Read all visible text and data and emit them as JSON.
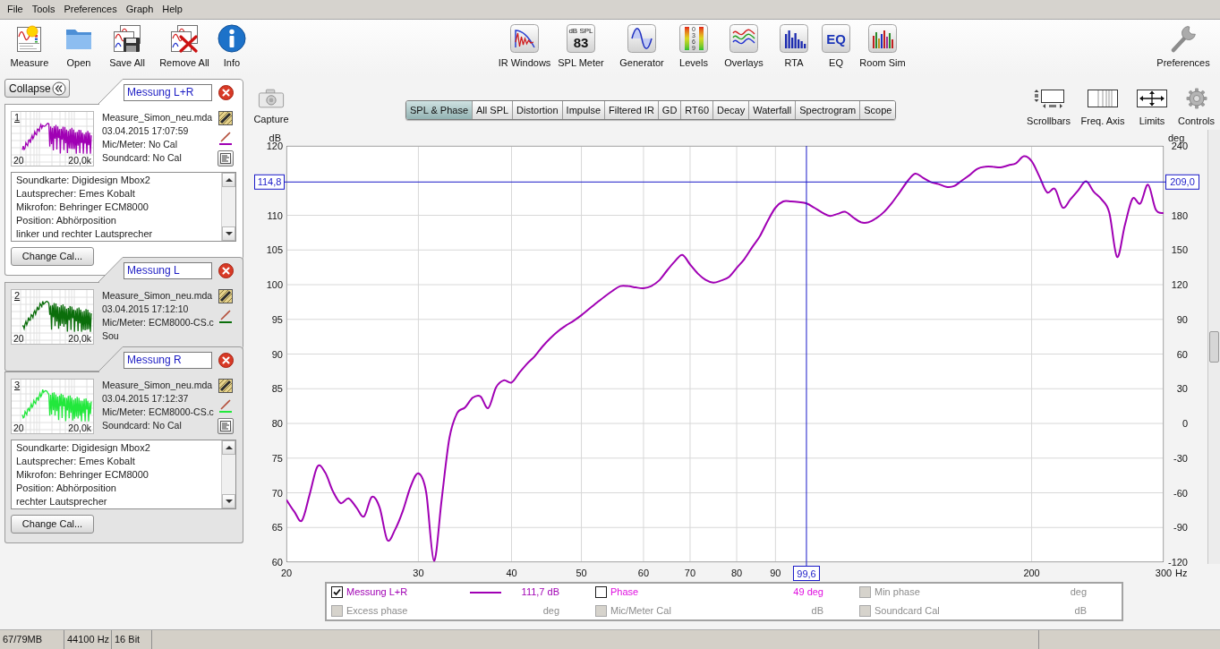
{
  "menu": [
    "File",
    "Tools",
    "Preferences",
    "Graph",
    "Help"
  ],
  "toolbar": {
    "left": [
      {
        "kind": "measure",
        "label": "Measure"
      },
      {
        "kind": "open",
        "label": "Open"
      },
      {
        "kind": "save-all",
        "label": "Save All"
      },
      {
        "kind": "remove-all",
        "label": "Remove All"
      },
      {
        "kind": "info",
        "label": "Info"
      }
    ],
    "center": [
      {
        "kind": "ir-windows",
        "label": "IR Windows"
      },
      {
        "kind": "spl-meter",
        "label": "SPL Meter",
        "display_unit": "dB SPL",
        "display_value": "83"
      },
      {
        "kind": "generator",
        "label": "Generator"
      },
      {
        "kind": "levels",
        "label": "Levels",
        "scale": "0369"
      },
      {
        "kind": "overlays",
        "label": "Overlays"
      },
      {
        "kind": "rta",
        "label": "RTA"
      },
      {
        "kind": "eq",
        "label": "EQ",
        "logo": "EQ"
      },
      {
        "kind": "room-sim",
        "label": "Room Sim"
      }
    ],
    "right": [
      {
        "kind": "preferences",
        "label": "Preferences"
      }
    ]
  },
  "collapse_button": "Collapse",
  "measurements": [
    {
      "name": "Messung L+R",
      "selected": true,
      "color": "#a000b4",
      "number": "1",
      "range_start": "20",
      "range_end": "20,0k",
      "file": "Measure_Simon_neu.mda",
      "date": "03.04.2015 17:07:59",
      "mic": "Mic/Meter: No Cal",
      "soundcard": "Soundcard: No Cal",
      "notes": [
        "Soundkarte: Digidesign Mbox2",
        "Lautsprecher: Emes Kobalt",
        "Mikrofon: Behringer ECM8000",
        "Position: Abhörposition",
        "linker und rechter Lautsprecher"
      ],
      "change_cal": "Change Cal..."
    },
    {
      "name": "Messung L",
      "selected": false,
      "color": "#0b6e0b",
      "number": "2",
      "range_start": "20",
      "range_end": "20,0k",
      "file": "Measure_Simon_neu.mda",
      "date": "03.04.2015 17:12:10",
      "mic": "Mic/Meter: ECM8000-CS.c",
      "soundcard": "Sou"
    },
    {
      "name": "Messung R",
      "selected": false,
      "color": "#22e83c",
      "number": "3",
      "range_start": "20",
      "range_end": "20,0k",
      "file": "Measure_Simon_neu.mda",
      "date": "03.04.2015 17:12:37",
      "mic": "Mic/Meter: ECM8000-CS.c",
      "soundcard": "Soundcard: No Cal",
      "notes": [
        "Soundkarte: Digidesign Mbox2",
        "Lautsprecher: Emes Kobalt",
        "Mikrofon: Behringer ECM8000",
        "Position: Abhörposition",
        "rechter Lautsprecher"
      ],
      "change_cal": "Change Cal..."
    }
  ],
  "capture_button": "Capture",
  "graph_tabs": [
    {
      "label": "SPL & Phase",
      "selected": true
    },
    {
      "label": "All SPL",
      "selected": false
    },
    {
      "label": "Distortion",
      "selected": false
    },
    {
      "label": "Impulse",
      "selected": false
    },
    {
      "label": "Filtered IR",
      "selected": false
    },
    {
      "label": "GD",
      "selected": false
    },
    {
      "label": "RT60",
      "selected": false
    },
    {
      "label": "Decay",
      "selected": false
    },
    {
      "label": "Waterfall",
      "selected": false
    },
    {
      "label": "Spectrogram",
      "selected": false
    },
    {
      "label": "Scope",
      "selected": false
    }
  ],
  "view_tools": [
    {
      "kind": "scrollbars",
      "label": "Scrollbars"
    },
    {
      "kind": "freq-axis",
      "label": "Freq. Axis"
    },
    {
      "kind": "limits",
      "label": "Limits"
    },
    {
      "kind": "controls",
      "label": "Controls"
    }
  ],
  "chart": {
    "chart_data": {
      "type": "line",
      "xlabel": "Hz",
      "ylabel": "dB",
      "y2label": "deg",
      "grid": true,
      "categories": [
        "20",
        null,
        null,
        null,
        null,
        null,
        null,
        null,
        null,
        null,
        null,
        null,
        null,
        null,
        null,
        null,
        null,
        "30",
        null,
        null,
        null,
        null,
        null,
        null,
        null,
        null,
        null,
        null,
        null,
        "40",
        null,
        null,
        null,
        null,
        null,
        null,
        null,
        null,
        "50",
        null,
        null,
        null,
        null,
        null,
        null,
        null,
        "60",
        null,
        null,
        null,
        null,
        null,
        "70",
        null,
        null,
        null,
        null,
        null,
        "80",
        null,
        null,
        null,
        null,
        "90",
        null,
        null,
        null,
        null,
        null,
        null,
        null,
        null,
        null,
        null,
        null,
        null,
        null,
        null,
        null,
        null,
        null,
        null,
        null,
        null,
        null,
        null,
        null,
        null,
        null,
        null,
        null,
        null,
        null,
        null,
        null,
        null,
        "200",
        null,
        null,
        null,
        null,
        null,
        null,
        null,
        null,
        null,
        null,
        null,
        null,
        null,
        null,
        null,
        null,
        "300"
      ],
      "series": [
        {
          "color": "#a000b4",
          "values": [
            69.0,
            67.3,
            66.0,
            69.8,
            73.8,
            72.9,
            70.2,
            68.5,
            69.2,
            67.9,
            66.6,
            69.4,
            67.9,
            63.2,
            64.7,
            67.4,
            70.9,
            72.8,
            70.1,
            60.2,
            69.1,
            77.9,
            81.5,
            82.3,
            83.7,
            83.9,
            82.2,
            85.2,
            86.2,
            85.9,
            87.3,
            88.6,
            89.7,
            91.1,
            92.3,
            93.3,
            94.1,
            94.8,
            95.6,
            96.5,
            97.4,
            98.3,
            99.1,
            99.8,
            99.8,
            99.6,
            99.5,
            99.8,
            100.6,
            102.0,
            103.3,
            104.3,
            102.9,
            101.6,
            100.7,
            100.3,
            100.6,
            101.1,
            102.4,
            103.7,
            105.4,
            107.0,
            109.2,
            111.1,
            112.0,
            112.0,
            111.9,
            111.7,
            111.1,
            110.4,
            109.9,
            110.2,
            110.5,
            109.7,
            109.0,
            109.0,
            109.6,
            110.5,
            111.8,
            113.3,
            114.9,
            116.0,
            115.4,
            114.8,
            114.5,
            114.1,
            114.2,
            115.0,
            115.8,
            116.7,
            117.0,
            117.0,
            116.9,
            117.2,
            117.5,
            118.5,
            117.8,
            115.6,
            113.3,
            113.8,
            111.1,
            112.3,
            113.6,
            114.9,
            113.4,
            112.3,
            110.4,
            104.0,
            108.5,
            112.4,
            111.7,
            114.4,
            110.8,
            110.3
          ]
        }
      ],
      "ylim": [
        60,
        120
      ],
      "y2lim": [
        -120,
        240
      ],
      "yticks": [
        60,
        65,
        70,
        75,
        80,
        85,
        90,
        95,
        100,
        105,
        110,
        120
      ],
      "y2ticks": [
        -120,
        -90,
        -60,
        -30,
        0,
        30,
        60,
        90,
        120,
        150,
        180,
        240
      ],
      "ref_lines": [
        {
          "axis": "y",
          "value": 114.8,
          "label": "114,8",
          "color": "#1a1ac8"
        }
      ]
    },
    "cursor": {
      "frequency": "99,6",
      "phase": "209,0"
    }
  },
  "legend": [
    {
      "kind": "trace",
      "label": "Messung L+R",
      "checked": true,
      "disabled": false,
      "color": "#a000b4",
      "reading": "111,7 dB"
    },
    {
      "kind": "option",
      "label": "Phase",
      "checked": false,
      "disabled": false,
      "color": "#e010e0",
      "reading": "49 deg"
    },
    {
      "kind": "option",
      "label": "Min phase",
      "checked": false,
      "disabled": true,
      "reading": "deg"
    },
    {
      "kind": "option",
      "label": "Excess phase",
      "checked": false,
      "disabled": true,
      "reading": "deg"
    },
    {
      "kind": "option",
      "label": "Mic/Meter Cal",
      "checked": false,
      "disabled": true,
      "reading": "dB"
    },
    {
      "kind": "option",
      "label": "Soundcard Cal",
      "checked": false,
      "disabled": true,
      "reading": "dB"
    }
  ],
  "status_bar": [
    "67/79MB",
    "44100 Hz",
    "16 Bit"
  ]
}
